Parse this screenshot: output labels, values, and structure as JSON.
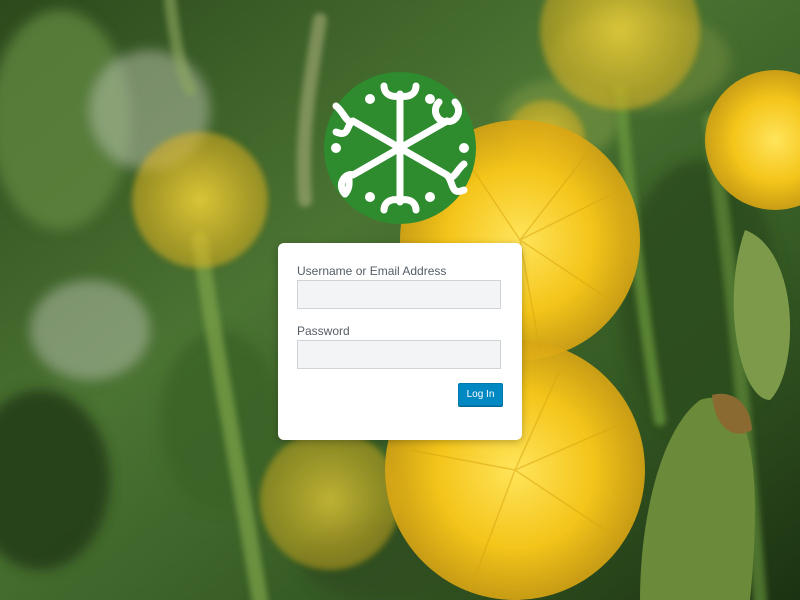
{
  "background": {
    "description_icon": "dandelion-photo",
    "colors": {
      "foliage_dark": "#1f3614",
      "foliage_mid": "#3f6a2a",
      "foliage_light": "#6d8f3d",
      "flower_yellow": "#f4c51a",
      "flower_highlight": "#ffe45a"
    }
  },
  "logo": {
    "icon": "snowflake-emblem",
    "color": "#2e8b2e"
  },
  "login": {
    "username_label": "Username or Email Address",
    "username_value": "",
    "password_label": "Password",
    "password_value": "",
    "submit_label": "Log In"
  },
  "colors": {
    "button": "#0088c2",
    "card": "#ffffff",
    "input_bg": "#f3f4f5"
  }
}
